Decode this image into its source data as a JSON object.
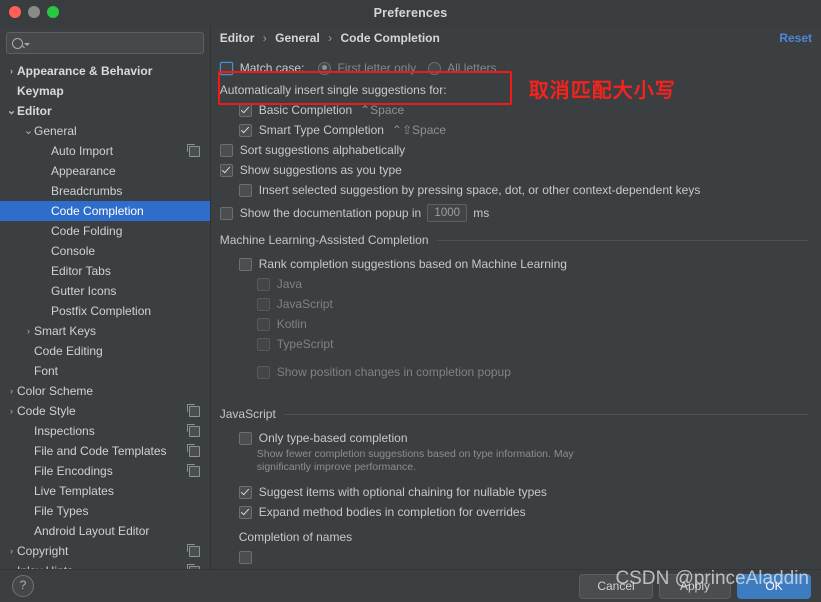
{
  "window": {
    "title": "Preferences",
    "traffic_lights": [
      "close-red",
      "minimize-gray",
      "zoom-green"
    ]
  },
  "search": {
    "value": "",
    "placeholder": ""
  },
  "sidebar": {
    "items": [
      {
        "label": "Appearance & Behavior",
        "indent": 0,
        "arrow": "collapsed",
        "bold": true,
        "selected": false,
        "copy_icon": false
      },
      {
        "label": "Keymap",
        "indent": 0,
        "arrow": "none",
        "bold": true,
        "selected": false,
        "copy_icon": false
      },
      {
        "label": "Editor",
        "indent": 0,
        "arrow": "expanded",
        "bold": true,
        "selected": false,
        "copy_icon": false
      },
      {
        "label": "General",
        "indent": 1,
        "arrow": "expanded",
        "bold": false,
        "selected": false,
        "copy_icon": false
      },
      {
        "label": "Auto Import",
        "indent": 2,
        "arrow": "none",
        "bold": false,
        "selected": false,
        "copy_icon": true
      },
      {
        "label": "Appearance",
        "indent": 2,
        "arrow": "none",
        "bold": false,
        "selected": false,
        "copy_icon": false
      },
      {
        "label": "Breadcrumbs",
        "indent": 2,
        "arrow": "none",
        "bold": false,
        "selected": false,
        "copy_icon": false
      },
      {
        "label": "Code Completion",
        "indent": 2,
        "arrow": "none",
        "bold": false,
        "selected": true,
        "copy_icon": false
      },
      {
        "label": "Code Folding",
        "indent": 2,
        "arrow": "none",
        "bold": false,
        "selected": false,
        "copy_icon": false
      },
      {
        "label": "Console",
        "indent": 2,
        "arrow": "none",
        "bold": false,
        "selected": false,
        "copy_icon": false
      },
      {
        "label": "Editor Tabs",
        "indent": 2,
        "arrow": "none",
        "bold": false,
        "selected": false,
        "copy_icon": false
      },
      {
        "label": "Gutter Icons",
        "indent": 2,
        "arrow": "none",
        "bold": false,
        "selected": false,
        "copy_icon": false
      },
      {
        "label": "Postfix Completion",
        "indent": 2,
        "arrow": "none",
        "bold": false,
        "selected": false,
        "copy_icon": false
      },
      {
        "label": "Smart Keys",
        "indent": 1,
        "arrow": "collapsed",
        "bold": false,
        "selected": false,
        "copy_icon": false
      },
      {
        "label": "Code Editing",
        "indent": 1,
        "arrow": "none",
        "bold": false,
        "selected": false,
        "copy_icon": false
      },
      {
        "label": "Font",
        "indent": 1,
        "arrow": "none",
        "bold": false,
        "selected": false,
        "copy_icon": false
      },
      {
        "label": "Color Scheme",
        "indent": 0,
        "arrow": "collapsed",
        "bold": false,
        "selected": false,
        "copy_icon": false
      },
      {
        "label": "Code Style",
        "indent": 0,
        "arrow": "collapsed",
        "bold": false,
        "selected": false,
        "copy_icon": true
      },
      {
        "label": "Inspections",
        "indent": 1,
        "arrow": "none",
        "bold": false,
        "selected": false,
        "copy_icon": true
      },
      {
        "label": "File and Code Templates",
        "indent": 1,
        "arrow": "none",
        "bold": false,
        "selected": false,
        "copy_icon": true
      },
      {
        "label": "File Encodings",
        "indent": 1,
        "arrow": "none",
        "bold": false,
        "selected": false,
        "copy_icon": true
      },
      {
        "label": "Live Templates",
        "indent": 1,
        "arrow": "none",
        "bold": false,
        "selected": false,
        "copy_icon": false
      },
      {
        "label": "File Types",
        "indent": 1,
        "arrow": "none",
        "bold": false,
        "selected": false,
        "copy_icon": false
      },
      {
        "label": "Android Layout Editor",
        "indent": 1,
        "arrow": "none",
        "bold": false,
        "selected": false,
        "copy_icon": false
      },
      {
        "label": "Copyright",
        "indent": 0,
        "arrow": "collapsed",
        "bold": false,
        "selected": false,
        "copy_icon": true
      },
      {
        "label": "Inlay Hints",
        "indent": 0,
        "arrow": "collapsed",
        "bold": false,
        "selected": false,
        "copy_icon": true
      }
    ]
  },
  "breadcrumb": {
    "part1": "Editor",
    "part2": "General",
    "part3": "Code Completion",
    "separator": "›"
  },
  "header": {
    "reset_label": "Reset"
  },
  "annotation": {
    "text": "取消匹配大小写",
    "color": "#f5221e"
  },
  "settings": {
    "match_case": {
      "label": "Match case:",
      "checked": false,
      "radio_first_letter": "First letter only",
      "radio_all_letters": "All letters",
      "radio_selected": "First letter only"
    },
    "auto_insert_header": "Automatically insert single suggestions for:",
    "basic_completion": {
      "label": "Basic Completion",
      "shortcut": "⌃Space",
      "checked": true
    },
    "smart_type_completion": {
      "label": "Smart Type Completion",
      "shortcut": "⌃⇧Space",
      "checked": true
    },
    "sort_alphabetically": {
      "label": "Sort suggestions alphabetically",
      "checked": false
    },
    "show_suggestions": {
      "label": "Show suggestions as you type",
      "checked": true
    },
    "insert_selected": {
      "label": "Insert selected suggestion by pressing space, dot, or other context-dependent keys",
      "checked": false
    },
    "doc_popup": {
      "label": "Show the documentation popup in",
      "value": "1000",
      "unit": "ms",
      "checked": false
    },
    "ml_section": "Machine Learning-Assisted Completion",
    "ml_rank": {
      "label": "Rank completion suggestions based on Machine Learning",
      "checked": false
    },
    "ml_languages": [
      {
        "label": "Java",
        "checked": false
      },
      {
        "label": "JavaScript",
        "checked": false
      },
      {
        "label": "Kotlin",
        "checked": false
      },
      {
        "label": "TypeScript",
        "checked": false
      }
    ],
    "ml_position_changes": {
      "label": "Show position changes in completion popup",
      "checked": false
    },
    "js_section": "JavaScript",
    "only_type_based": {
      "label": "Only type-based completion",
      "checked": false
    },
    "only_type_based_note": "Show fewer completion suggestions based on type information. May significantly improve performance.",
    "optional_chaining": {
      "label": "Suggest items with optional chaining for nullable types",
      "checked": true
    },
    "expand_method_bodies": {
      "label": "Expand method bodies in completion for overrides",
      "checked": true
    },
    "completion_of_names": "Completion of names"
  },
  "footer": {
    "help": "?",
    "cancel": "Cancel",
    "apply": "Apply",
    "ok": "OK"
  },
  "watermark": {
    "text": "CSDN @princeAladdin"
  },
  "colors": {
    "accent_selection": "#2f6dcb",
    "link": "#4b88d8",
    "annotation_red": "#f5221e",
    "ok_button": "#3d7cc0",
    "background": "#3c3f41"
  }
}
